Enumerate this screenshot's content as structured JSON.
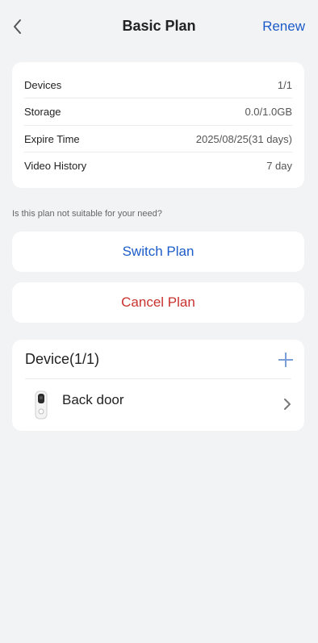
{
  "header": {
    "title": "Basic Plan",
    "renew_label": "Renew"
  },
  "plan_info": [
    {
      "label": "Devices",
      "value": "1/1"
    },
    {
      "label": "Storage",
      "value": "0.0/1.0GB"
    },
    {
      "label": "Expire Time",
      "value": "2025/08/25(31 days)"
    },
    {
      "label": "Video History",
      "value": "7 day"
    }
  ],
  "hint": "Is this plan not suitable for your need?",
  "actions": {
    "switch_label": "Switch Plan",
    "cancel_label": "Cancel Plan"
  },
  "devices": {
    "header": "Device(1/1)",
    "items": [
      {
        "name": "Back door",
        "icon": "doorbell-camera-icon"
      }
    ]
  },
  "colors": {
    "accent": "#1c5cc9",
    "danger": "#c8322e",
    "background": "#f2f3f5"
  }
}
